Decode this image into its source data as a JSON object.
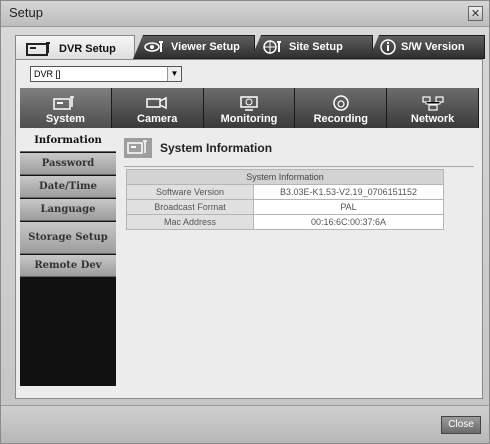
{
  "window": {
    "title": "Setup",
    "close_glyph": "✕"
  },
  "top_tabs": [
    {
      "label": "DVR Setup",
      "icon": "dvr-setup-icon",
      "active": true
    },
    {
      "label": "Viewer Setup",
      "icon": "viewer-setup-icon",
      "active": false
    },
    {
      "label": "Site Setup",
      "icon": "site-setup-icon",
      "active": false
    },
    {
      "label": "S/W Version",
      "icon": "info-icon",
      "active": false
    }
  ],
  "dvr_select": {
    "value": "DVR []",
    "arrow": "▼"
  },
  "categories": [
    {
      "label": "System",
      "icon": "system-icon",
      "active": true
    },
    {
      "label": "Camera",
      "icon": "camera-icon",
      "active": false
    },
    {
      "label": "Monitoring",
      "icon": "monitor-icon",
      "active": false
    },
    {
      "label": "Recording",
      "icon": "recording-icon",
      "active": false
    },
    {
      "label": "Network",
      "icon": "network-icon",
      "active": false
    }
  ],
  "side_menu": [
    {
      "label": "Information",
      "active": true
    },
    {
      "label": "Password",
      "active": false
    },
    {
      "label": "Date/Time",
      "active": false
    },
    {
      "label": "Language",
      "active": false
    },
    {
      "label": "Storage Setup",
      "active": false
    },
    {
      "label": "Remote Dev",
      "active": false
    }
  ],
  "panel": {
    "title": "System Information",
    "table_header": "System Information",
    "rows": [
      {
        "label": "Software Version",
        "value": "B3.03E-K1.53-V2.19_0706151152"
      },
      {
        "label": "Broadcast Format",
        "value": "PAL"
      },
      {
        "label": "Mac Address",
        "value": "00:16:6C:00:37:6A"
      }
    ]
  },
  "footer": {
    "close_label": "Close"
  }
}
